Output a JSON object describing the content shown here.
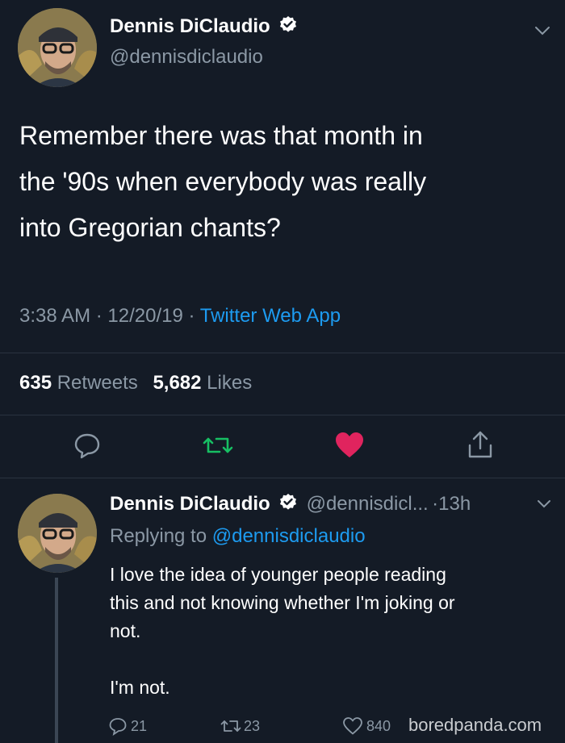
{
  "main_tweet": {
    "author_name": "Dennis DiClaudio",
    "author_handle": "@dennisdiclaudio",
    "text_lines": [
      "Remember there was that month in",
      "the '90s when everybody was really",
      "into Gregorian chants?"
    ],
    "time": "3:38 AM",
    "sep1": "·",
    "date": "12/20/19",
    "sep2": "·",
    "source": "Twitter Web App",
    "retweets_count": "635",
    "retweets_label": "Retweets",
    "likes_count": "5,682",
    "likes_label": "Likes"
  },
  "reply_tweet": {
    "author_name": "Dennis DiClaudio",
    "author_handle": "@dennisdicl...",
    "age": "·13h",
    "replying_prefix": "Replying to",
    "replying_handle": "@dennisdiclaudio",
    "text_lines": [
      "I love the idea of younger people reading",
      "this and not knowing whether I'm joking or",
      "not.",
      "I'm not."
    ],
    "reply_count": "21",
    "retweet_count": "23",
    "like_count": "840"
  },
  "watermark": "boredpanda.com",
  "colors": {
    "background": "#141b26",
    "accent_blue": "#1d9bf0",
    "retweet_green": "#17bf63",
    "like_red": "#e0245e",
    "muted": "#8b98a5"
  },
  "icons": [
    "verified-badge-icon",
    "chevron-down-icon",
    "reply-icon",
    "retweet-icon",
    "like-heart-icon",
    "share-icon"
  ]
}
